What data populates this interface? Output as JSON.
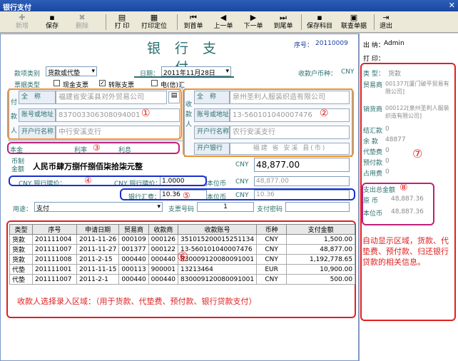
{
  "window": {
    "title": "银行支付",
    "close": "✕"
  },
  "toolbar": [
    {
      "label": "新增",
      "icon": "✚",
      "enabled": false
    },
    {
      "label": "保存",
      "icon": "▪",
      "enabled": true
    },
    {
      "label": "删除",
      "icon": "✖",
      "enabled": false
    },
    {
      "label": "打 印",
      "icon": "▤",
      "enabled": true
    },
    {
      "label": "打印定位",
      "icon": "▦",
      "enabled": true
    },
    {
      "label": "到首单",
      "icon": "⏮",
      "enabled": true
    },
    {
      "label": "上一单",
      "icon": "◀",
      "enabled": true
    },
    {
      "label": "下一单",
      "icon": "▶",
      "enabled": true
    },
    {
      "label": "到尾单",
      "icon": "⏭",
      "enabled": true
    },
    {
      "label": "保存科目",
      "icon": "▪",
      "enabled": true
    },
    {
      "label": "联查单据",
      "icon": "▣",
      "enabled": true
    },
    {
      "label": "退出",
      "icon": "⇥",
      "enabled": true
    }
  ],
  "form": {
    "title": "银 行 支 付",
    "seq_label": "序号：",
    "seq_value": "20110009",
    "type_label": "款项类别",
    "type_value": "货款或代垫",
    "date_label": "日期：",
    "date_value": "2011年11月28日",
    "currency_label": "收款户币种：",
    "currency_value": "CNY",
    "bill_label": "票据类型",
    "bill_options": [
      {
        "label": "现金支票",
        "checked": false
      },
      {
        "label": "转账支票",
        "checked": true
      },
      {
        "label": "电(信)汇",
        "checked": false
      }
    ],
    "payer_side": "付款人",
    "payer": {
      "name_label": "全　称",
      "name": "福建省安溪县对外贸易公司",
      "acct_label": "账号或地址",
      "acct": "837003306308094001",
      "bank_label": "开户行名称",
      "bank": "中行安溪支行"
    },
    "payee_side": "收款人",
    "payee": {
      "name_label": "全　称",
      "name": "泉州圣利人服装织造有限公司",
      "acct_label": "账号或地址",
      "acct": "13-560101040007476",
      "bank_label": "开户行名称",
      "bank": "农行安溪支行",
      "open_label": "开户银行",
      "open": "福建 省 安溪 县(市)"
    },
    "principal_label": "本金",
    "rate_label": "利率",
    "interest_label": "利息",
    "amount_label": "币制金额",
    "amount_cn": "人民币肆万捌仟捌佰柒拾柒元整",
    "amount_cur": "CNY",
    "amount_value": "48,877.00",
    "cny_rate_label": "CNY 银行牌价：",
    "cny_rate2_label": "CNY 银行牌价：",
    "cny_rate2": "1.0000",
    "local_label": "本位币",
    "local_cur": "CNY",
    "local_value": "48,877.00",
    "fee_label": "银行汇费：",
    "fee_value": "10.36",
    "fee_local_label": "本位币",
    "fee_cur": "CNY",
    "fee_value2": "10.36",
    "use_label": "用途：",
    "use_value": "支付",
    "voucher_label": "支票号码",
    "voucher_value": "1",
    "pwd_label": "支付密码"
  },
  "markers": {
    "m1": "①",
    "m2": "②",
    "m3": "③",
    "m4": "④",
    "m5": "⑤",
    "m6": "⑥",
    "m7": "⑦",
    "m8": "⑧"
  },
  "table": {
    "headers": [
      "类型",
      "序号",
      "申请日期",
      "贸易商",
      "收款商",
      "收款账号",
      "币种",
      "支付金额"
    ],
    "rows": [
      [
        "货款",
        "201111004",
        "2011-11-26",
        "000109",
        "000126",
        "351015200015251134",
        "CNY",
        "1,500.00"
      ],
      [
        "货款",
        "201111007",
        "2011-11-27",
        "001377",
        "000122",
        "13-560101040007476",
        "CNY",
        "48,877.00"
      ],
      [
        "货款",
        "201111008",
        "2011-2-15",
        "000440",
        "000440",
        "830009120080091001",
        "CNY",
        "1,192,778.65"
      ],
      [
        "代垫",
        "201111001",
        "2011-11-15",
        "000113",
        "900001",
        "13213464",
        "EUR",
        "10,900.00"
      ],
      [
        "代垫",
        "201111007",
        "2011-2-1",
        "000440",
        "000440",
        "830009120080091001",
        "CNY",
        "500.00"
      ]
    ],
    "note": "收款人选择录入区域：（用于货款、代垫费、预付款、银行贷款支付）"
  },
  "right": {
    "cashier_label": "出 纳：",
    "cashier": "Admin",
    "print_label": "打 印：",
    "type_label": "类 型：",
    "type_value": "货款",
    "trader_label": "贸易商",
    "trader_value": "001377[厦门破平贸易有限公司]",
    "seller_label": "销货商",
    "seller_value": "000122[泉州圣利人服装织造有限公司]",
    "rows": [
      {
        "label": "结汇款",
        "value": "0"
      },
      {
        "label": "余 款",
        "value": "48877"
      },
      {
        "label": "代垫费",
        "value": "0"
      },
      {
        "label": "预付款",
        "value": "0"
      },
      {
        "label": "占用费",
        "value": "0"
      }
    ],
    "total_label": "支出总金额",
    "orig_label": "原 币",
    "orig_value": "48,887.36",
    "base_label": "本位币",
    "base_value": "48,887.36",
    "note": "自动显示区域，货款、代垫费、预付款、归还银行贷款的相关信息。"
  }
}
